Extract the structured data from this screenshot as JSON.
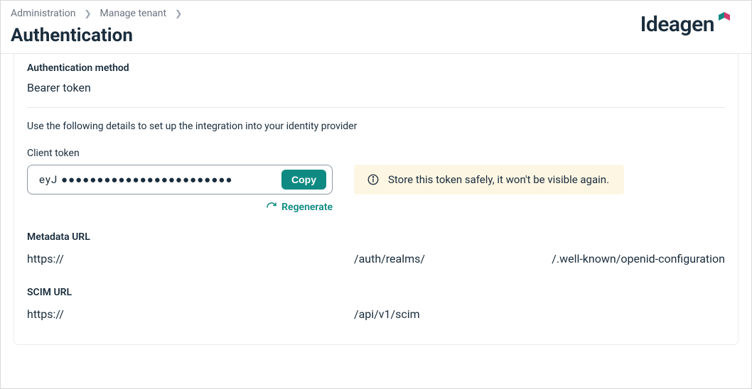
{
  "breadcrumb": {
    "items": [
      "Administration",
      "Manage tenant"
    ]
  },
  "page": {
    "title": "Authentication"
  },
  "brand": {
    "name": "Ideagen"
  },
  "auth": {
    "method_label": "Authentication method",
    "method_value": "Bearer token",
    "instructions": "Use the following details to set up the integration into your identity provider",
    "client_token_label": "Client token",
    "client_token_value": "eyJ ●●●●●●●●●●●●●●●●●●●●●●●●",
    "copy_label": "Copy",
    "regenerate_label": "Regenerate",
    "alert_text": "Store this token safely, it won't be visible again."
  },
  "metadata": {
    "label": "Metadata URL",
    "seg1": "https://",
    "seg2": "/auth/realms/",
    "seg3": "/.well-known/openid-configuration"
  },
  "scim": {
    "label": "SCIM URL",
    "seg1": "https://",
    "seg2": "/api/v1/scim"
  }
}
